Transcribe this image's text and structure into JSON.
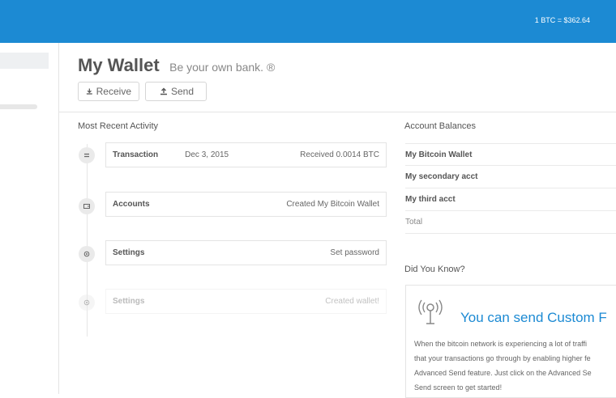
{
  "topbar": {
    "price": "1 BTC = $362.64"
  },
  "sidebar": {
    "progress_fraction": 0.07
  },
  "header": {
    "title": "My Wallet",
    "subtitle": "Be your own bank. ®",
    "receive_label": "Receive",
    "send_label": "Send"
  },
  "activity": {
    "title": "Most Recent Activity",
    "items": [
      {
        "label": "Transaction",
        "date": "Dec 3, 2015",
        "detail": "Received 0.0014 BTC",
        "icon": "transaction-icon"
      },
      {
        "label": "Accounts",
        "date": "",
        "detail": "Created My Bitcoin Wallet",
        "icon": "wallet-icon"
      },
      {
        "label": "Settings",
        "date": "",
        "detail": "Set password",
        "icon": "gear-icon"
      },
      {
        "label": "Settings",
        "date": "",
        "detail": "Created wallet!",
        "icon": "gear-icon"
      }
    ]
  },
  "balances": {
    "title": "Account Balances",
    "rows": [
      "My Bitcoin Wallet",
      "My secondary acct",
      "My third acct",
      "Total"
    ]
  },
  "did_you_know": {
    "title": "Did You Know?",
    "heading": "You can send Custom F",
    "body_lines": [
      "When the bitcoin network is experiencing a lot of traffi",
      "that your transactions go through by enabling higher fe",
      "Advanced Send feature. Just click on the Advanced Se",
      "Send screen to get started!"
    ]
  },
  "colors": {
    "topbar": "#1c8ad3",
    "accent": "#1c8ad3",
    "progress": "#e36a6a"
  }
}
